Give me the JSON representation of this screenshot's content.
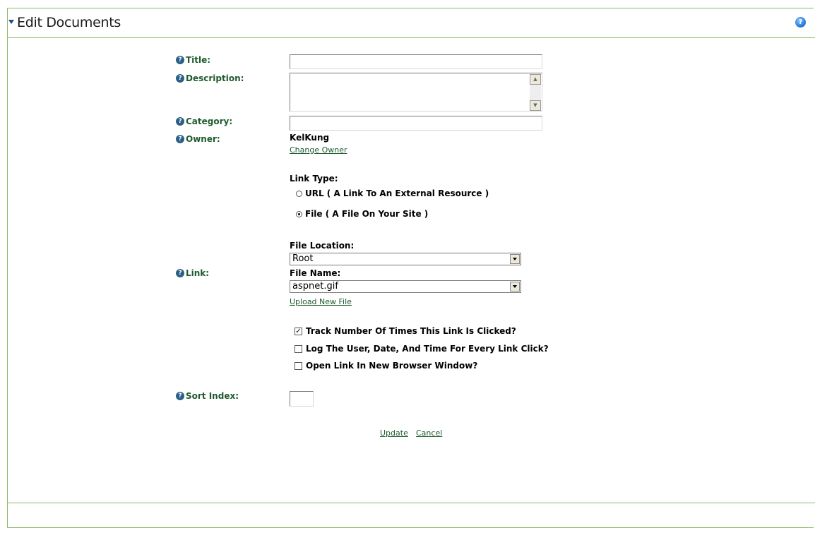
{
  "module": {
    "title": "Edit Documents"
  },
  "form": {
    "title_label": "Title:",
    "title_value": "",
    "description_label": "Description:",
    "description_value": "",
    "category_label": "Category:",
    "category_value": "",
    "owner_label": "Owner:",
    "owner_name": "KelKung",
    "change_owner": "Change Owner",
    "link_label": "Link:",
    "link_type_label": "Link Type:",
    "link_type_url": "URL ( A Link To An External Resource )",
    "link_type_file": "File ( A File On Your Site )",
    "file_location_label": "File Location:",
    "file_location_value": "Root",
    "file_name_label": "File Name:",
    "file_name_value": "aspnet.gif",
    "upload_new_file": "Upload New File",
    "track_clicks": "Track Number Of Times This Link Is Clicked?",
    "log_user": "Log The User, Date, And Time For Every Link Click?",
    "open_new_window": "Open Link In New Browser Window?",
    "sort_index_label": "Sort Index:",
    "sort_index_value": ""
  },
  "actions": {
    "update": "Update",
    "cancel": "Cancel"
  },
  "colors": {
    "accent_green": "#1f5b2e",
    "border_green": "#8aba63",
    "help_blue": "#1c6fd6"
  }
}
